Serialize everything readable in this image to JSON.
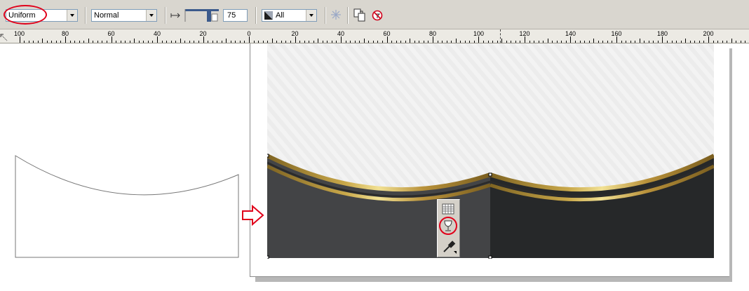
{
  "toolbar": {
    "fill_type": "Uniform",
    "merge_mode": "Normal",
    "transparency_value": "75",
    "target": "All"
  },
  "ruler": {
    "labels": [
      "100",
      "80",
      "60",
      "40",
      "20",
      "0",
      "20",
      "40",
      "60",
      "80",
      "100",
      "120",
      "140",
      "160",
      "180",
      "200"
    ]
  },
  "colors": {
    "highlight": "#e0001a",
    "panel_dark": "#262829",
    "panel_mid": "#434446",
    "gold_light": "#e7d27f",
    "gold_dark": "#8a6d23",
    "background_top": "#f2f2f2"
  },
  "icons": [
    "interactive-transparency-icon",
    "copy-transparency-icon",
    "clear-transparency-icon",
    "grid-icon",
    "wineglass-icon",
    "eyedropper-icon",
    "hollow-arrow-right-icon"
  ]
}
